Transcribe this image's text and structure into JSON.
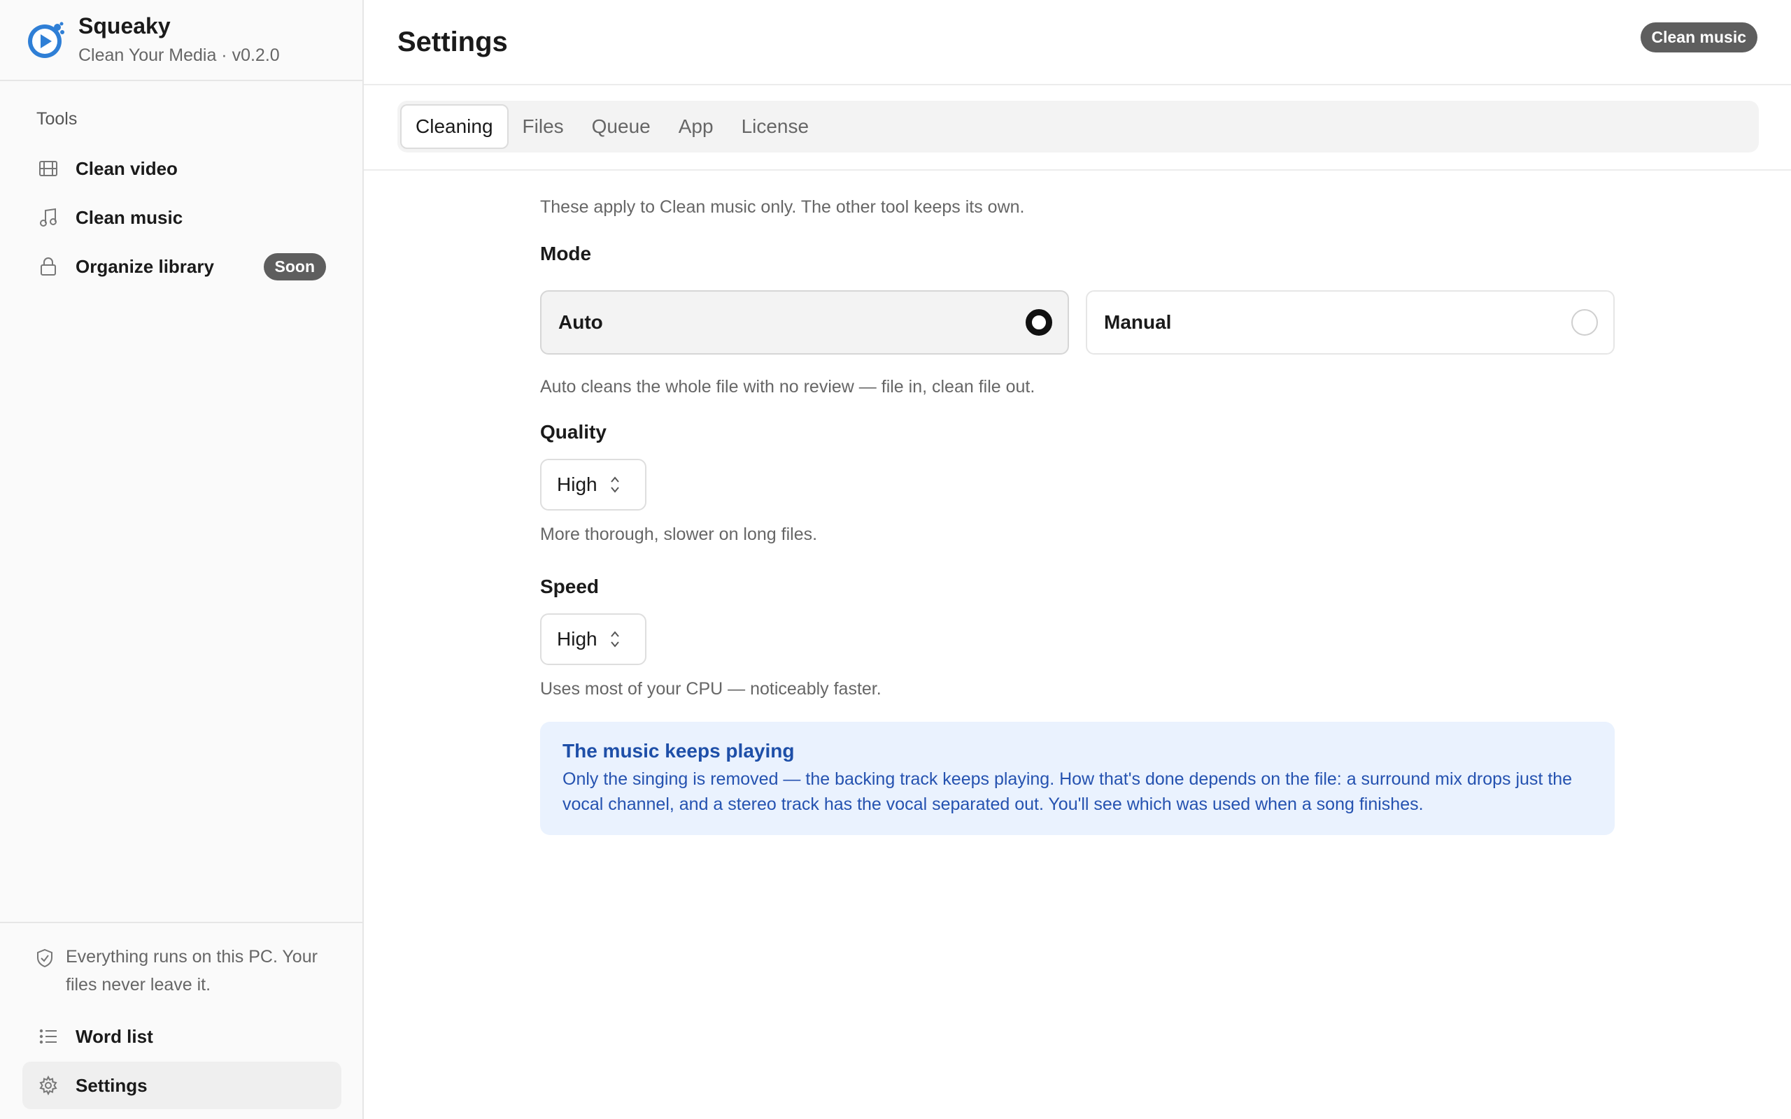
{
  "app": {
    "name": "Squeaky",
    "subtitle": "Clean Your Media · v0.2.0"
  },
  "sidebar": {
    "section_title": "Tools",
    "items": [
      {
        "label": "Clean video",
        "icon": "film-icon"
      },
      {
        "label": "Clean music",
        "icon": "music-note-icon"
      },
      {
        "label": "Organize library",
        "icon": "lock-icon",
        "badge": "Soon"
      }
    ],
    "privacy_note": "Everything runs on this PC. Your files never leave it.",
    "footer_items": [
      {
        "label": "Word list",
        "icon": "list-icon"
      },
      {
        "label": "Settings",
        "icon": "gear-icon",
        "active": true
      }
    ]
  },
  "header": {
    "title": "Settings",
    "context_badge": "Clean music"
  },
  "tabs": [
    {
      "label": "Cleaning",
      "active": true
    },
    {
      "label": "Files"
    },
    {
      "label": "Queue"
    },
    {
      "label": "App"
    },
    {
      "label": "License"
    }
  ],
  "cleaning": {
    "intro": "These apply to Clean music only. The other tool keeps its own.",
    "mode": {
      "title": "Mode",
      "options": [
        {
          "label": "Auto",
          "selected": true
        },
        {
          "label": "Manual",
          "selected": false
        }
      ],
      "help": "Auto cleans the whole file with no review — file in, clean file out."
    },
    "quality": {
      "title": "Quality",
      "value": "High",
      "help": "More thorough, slower on long files."
    },
    "speed": {
      "title": "Speed",
      "value": "High",
      "help": "Uses most of your CPU — noticeably faster."
    },
    "callout": {
      "title": "The music keeps playing",
      "body": "Only the singing is removed — the backing track keeps playing. How that's done depends on the file: a surround mix drops just the vocal channel, and a stereo track has the vocal separated out. You'll see which was used when a song finishes."
    }
  },
  "colors": {
    "accent_blue": "#2f7fd6",
    "badge_gray": "#5e5e5e",
    "callout_bg": "#eaf2fe",
    "callout_text": "#1e4fa8"
  }
}
